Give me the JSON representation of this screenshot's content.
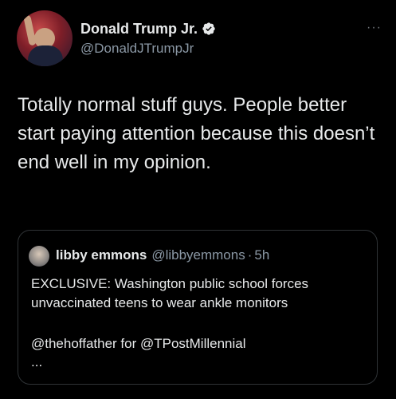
{
  "author": {
    "display_name": "Donald Trump Jr.",
    "handle": "@DonaldJTrumpJr",
    "verified_icon": "verified-badge-icon"
  },
  "more_label": "···",
  "tweet_text": "Totally normal stuff guys. People better start paying attention because this doesn’t end well in my opinion.",
  "quote": {
    "display_name": "libby emmons",
    "handle": "@libbyemmons",
    "separator": "·",
    "time": "5h",
    "body_line1": "EXCLUSIVE: Washington public school forces",
    "body_line2": "unvaccinated teens to wear ankle monitors",
    "credit": "@thehoffather for @TPostMillennial",
    "ellipsis": "..."
  },
  "colors": {
    "background": "#000000",
    "text": "#e7e9ea",
    "secondary_text": "#8b98a5",
    "border": "#2f3336",
    "verified": "#e7e9ea"
  }
}
